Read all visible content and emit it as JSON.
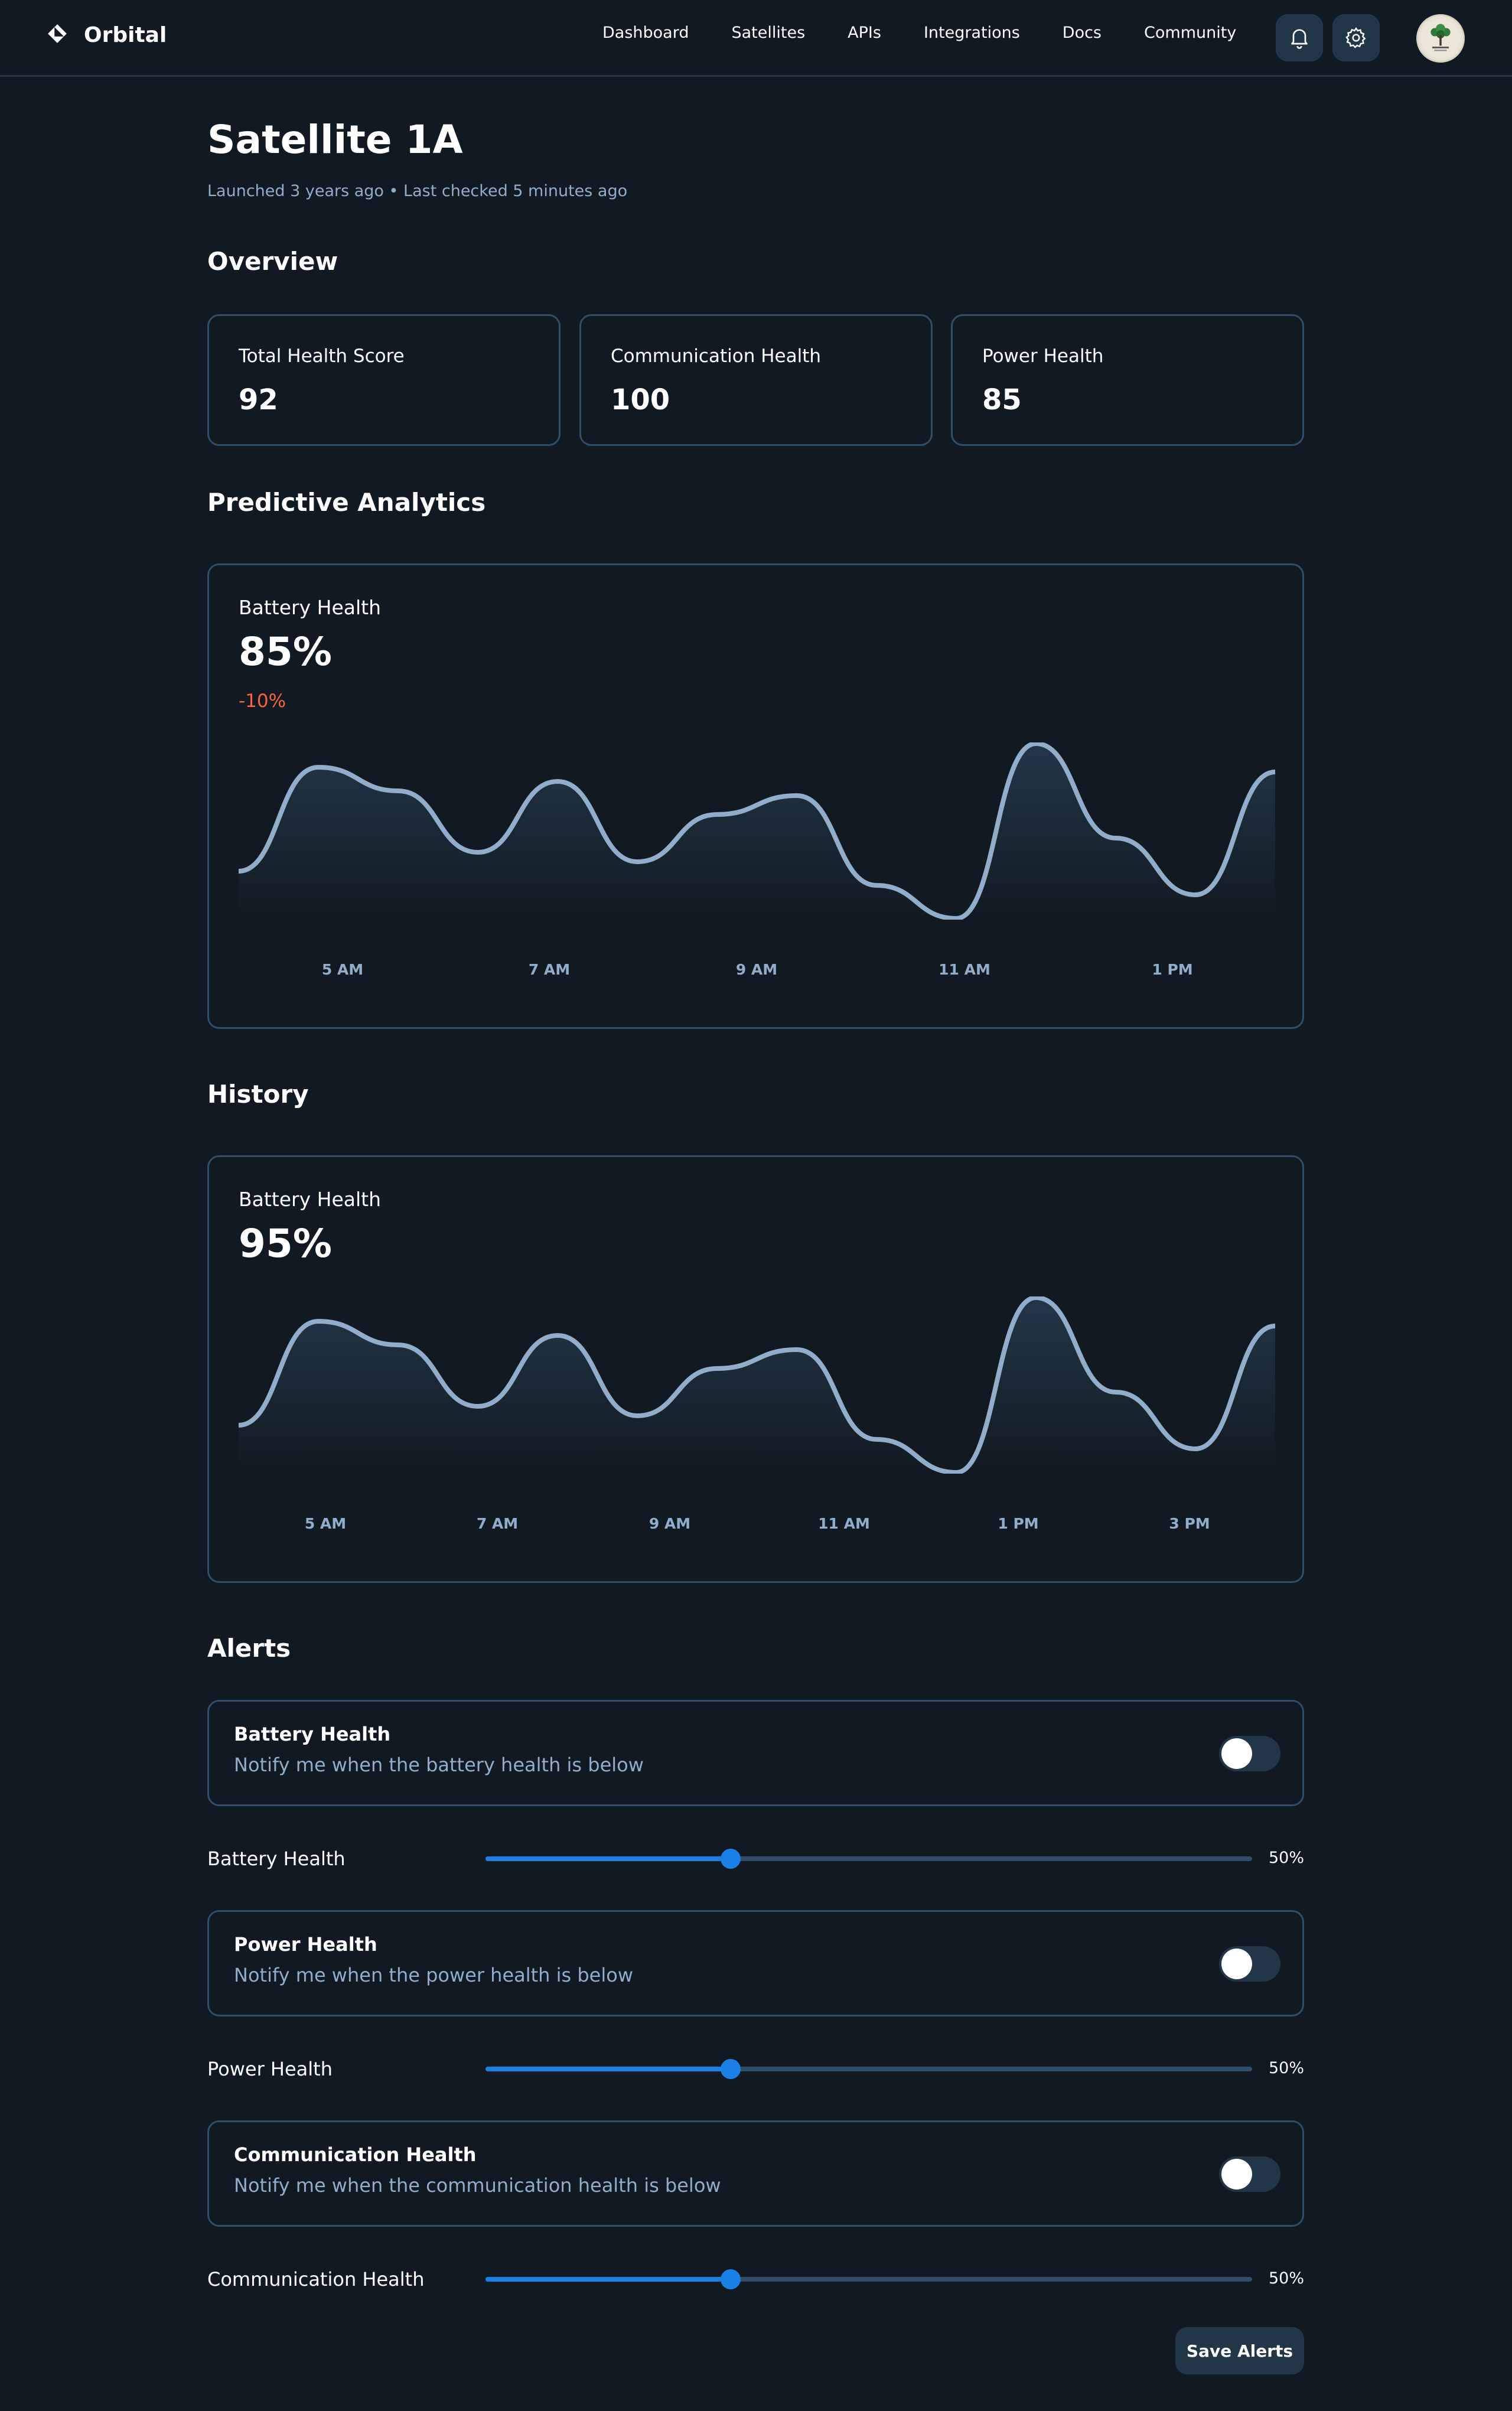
{
  "header": {
    "brand": "Orbital",
    "nav": [
      "Dashboard",
      "Satellites",
      "APIs",
      "Integrations",
      "Docs",
      "Community"
    ]
  },
  "page": {
    "title": "Satellite 1A",
    "subtitle": "Launched 3 years ago • Last checked 5 minutes ago"
  },
  "overview": {
    "title": "Overview",
    "cards": [
      {
        "label": "Total Health Score",
        "value": "92"
      },
      {
        "label": "Communication Health",
        "value": "100"
      },
      {
        "label": "Power Health",
        "value": "85"
      }
    ]
  },
  "predictive": {
    "title": "Predictive Analytics",
    "label": "Battery Health",
    "value": "85%",
    "delta": "-10%",
    "ticks": [
      "5 AM",
      "7 AM",
      "9 AM",
      "11 AM",
      "1 PM"
    ]
  },
  "history": {
    "title": "History",
    "label": "Battery Health",
    "value": "95%",
    "ticks": [
      "5 AM",
      "7 AM",
      "9 AM",
      "11 AM",
      "1 PM",
      "3 PM"
    ]
  },
  "alerts": {
    "title": "Alerts",
    "items": [
      {
        "title": "Battery Health",
        "desc": "Notify me when the battery health is below",
        "slider_label": "Battery Health",
        "value": "50%",
        "level": 0.32,
        "enabled": false
      },
      {
        "title": "Power Health",
        "desc": "Notify me when the power health is below",
        "slider_label": "Power Health",
        "value": "50%",
        "level": 0.32,
        "enabled": false
      },
      {
        "title": "Communication Health",
        "desc": "Notify me when the communication health is below",
        "slider_label": "Communication Health",
        "value": "50%",
        "level": 0.32,
        "enabled": false
      }
    ],
    "save_label": "Save Alerts"
  },
  "icons": [
    "orbital-logo-icon",
    "bell-icon",
    "gear-icon",
    "avatar"
  ],
  "colors": {
    "background": "#111a22",
    "border": "#324d67",
    "muted": "#92adc9",
    "accent": "#1a80e5",
    "negative": "#fa6238",
    "line": "#92adc9"
  }
}
